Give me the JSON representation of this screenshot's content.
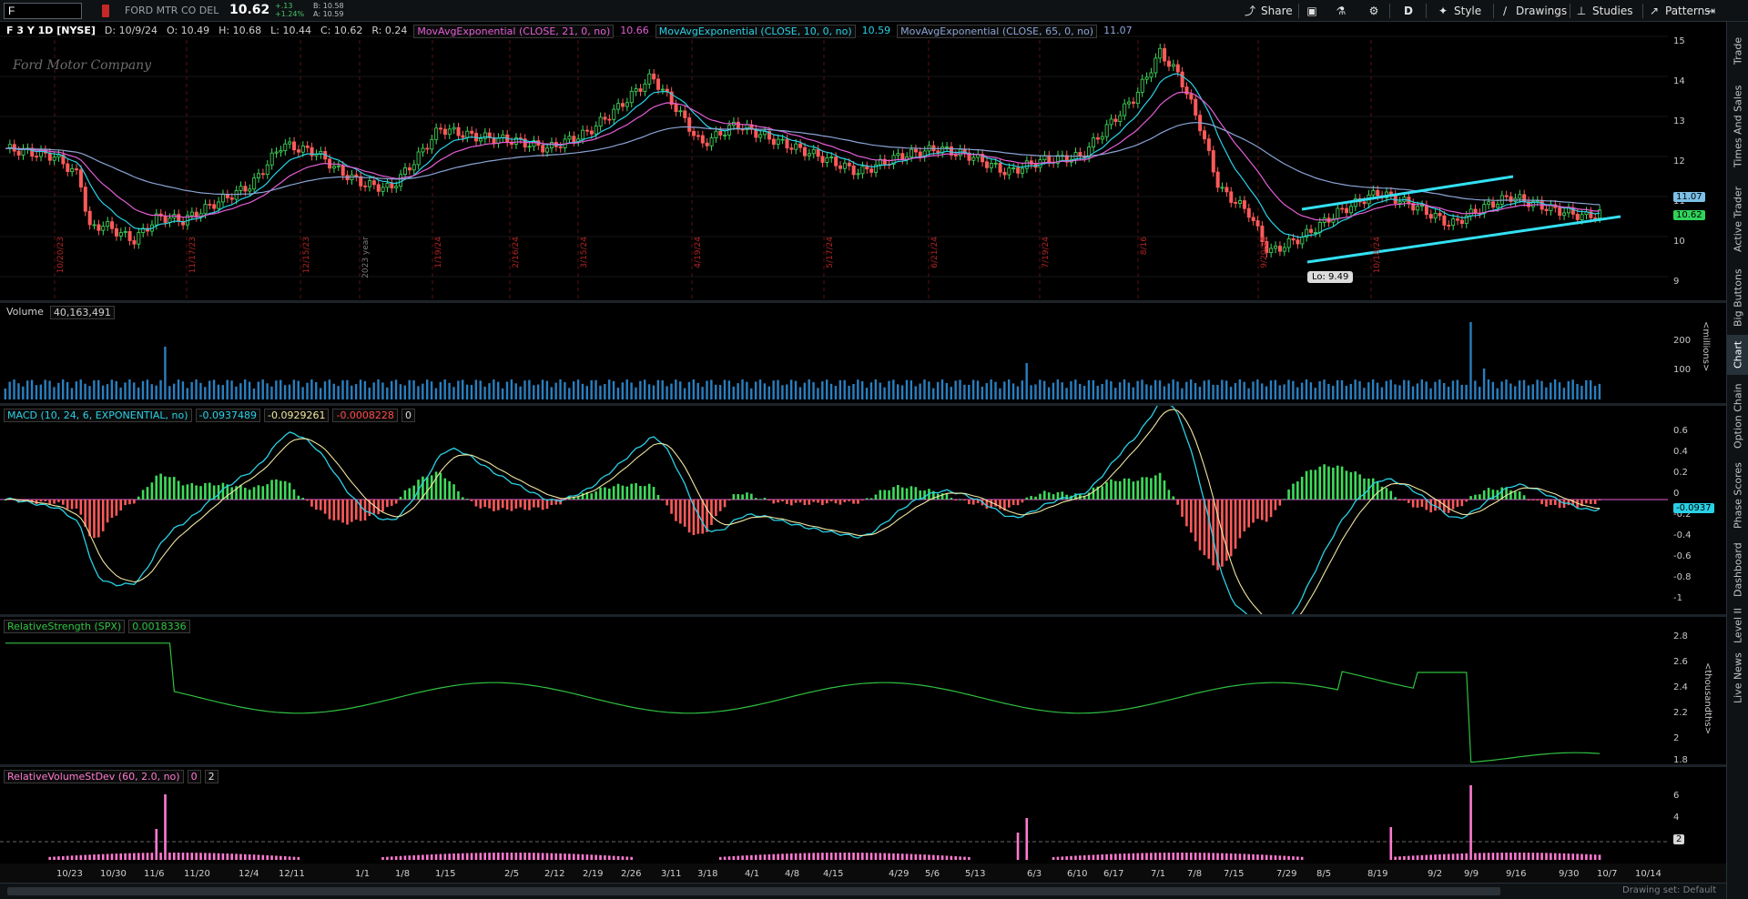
{
  "symbol": "F",
  "company": "FORD MTR CO DEL",
  "last": "10.62",
  "change_abs": "+.13",
  "change_pct": "+1.24%",
  "bid": "B: 10.58",
  "ask": "A: 10.59",
  "toolbar": {
    "share": "Share",
    "aggregation": "D",
    "style": "Style",
    "drawings": "Drawings",
    "studies": "Studies",
    "patterns": "Patterns"
  },
  "sidetabs": [
    "Trade",
    "Times And Sales",
    "Active Trader",
    "Big Buttons",
    "Chart",
    "Option Chain",
    "Phase Scores",
    "Dashboard",
    "Level II",
    "Live News"
  ],
  "price_panel": {
    "title": "F 3 Y 1D [NYSE]",
    "ohlc": [
      "D: 10/9/24",
      "O: 10.49",
      "H: 10.68",
      "L: 10.44",
      "C: 10.62",
      "R: 0.24"
    ],
    "studies": [
      {
        "label": "MovAvgExponential (CLOSE, 21, 0, no)",
        "value": "10.66",
        "color": "#e35ed6"
      },
      {
        "label": "MovAvgExponential (CLOSE, 10, 0, no)",
        "value": "10.59",
        "color": "#29d1e6"
      },
      {
        "label": "MovAvgExponential (CLOSE, 65, 0, no)",
        "value": "11.07",
        "color": "#8aa4d4"
      }
    ],
    "watermark": "Ford Motor Company",
    "low_label": "Lo: 9.49",
    "axis_ticks": [
      "15",
      "14",
      "13",
      "12",
      "11",
      "10",
      "9"
    ],
    "badge_ma65": "11.07",
    "badge_last": "10.62",
    "period_labels": [
      "10/20/23",
      "11/17/23",
      "12/15/23",
      "2023 year",
      "1/19/24",
      "2/16/24",
      "3/15/24",
      "4/19/24",
      "5/17/24",
      "6/21/24",
      "7/19/24",
      "8/16",
      "9/20/24",
      "10/18/24"
    ]
  },
  "volume_panel": {
    "title": "Volume",
    "value": "40,163,491",
    "axis_ticks": [
      "200",
      "100"
    ],
    "unit": "<millions>"
  },
  "macd_panel": {
    "title": "MACD (10, 24, 6, EXPONENTIAL, no)",
    "values": [
      "-0.0937489",
      "-0.0929261",
      "-0.0008228",
      "0"
    ],
    "axis_ticks": [
      "0.6",
      "0.4",
      "0.2",
      "0",
      "-0.2",
      "-0.4",
      "-0.6",
      "-0.8",
      "-1"
    ],
    "badge": "-0.0937"
  },
  "rs_panel": {
    "title": "RelativeStrength (SPX)",
    "value": "0.0018336",
    "axis_ticks": [
      "2.8",
      "2.6",
      "2.4",
      "2.2",
      "2",
      "1.8"
    ],
    "unit": "<thousandths>"
  },
  "rvol_panel": {
    "title": "RelativeVolumeStDev (60, 2.0, no)",
    "values": [
      "0",
      "2"
    ],
    "axis_ticks": [
      "6",
      "4",
      "2"
    ],
    "badge": "2"
  },
  "x_axis": [
    "10/23",
    "10/30",
    "11/6",
    "11/20",
    "12/4",
    "12/11",
    "1/1",
    "1/8",
    "1/15",
    "2/5",
    "2/12",
    "2/19",
    "2/26",
    "3/11",
    "3/18",
    "4/1",
    "4/8",
    "4/15",
    "4/29",
    "5/6",
    "5/13",
    "6/3",
    "6/10",
    "6/17",
    "7/1",
    "7/8",
    "7/15",
    "7/29",
    "8/5",
    "8/19",
    "9/2",
    "9/9",
    "9/16",
    "9/30",
    "10/7",
    "10/14"
  ],
  "footer_status": "Drawing set: Default",
  "colors": {
    "up": "#3ddc5a",
    "down": "#ff5a5a",
    "trend": "#33e0f2",
    "volume": "#2a7fc0",
    "rvol": "#ff7ad0",
    "rs": "#2fc040"
  }
}
